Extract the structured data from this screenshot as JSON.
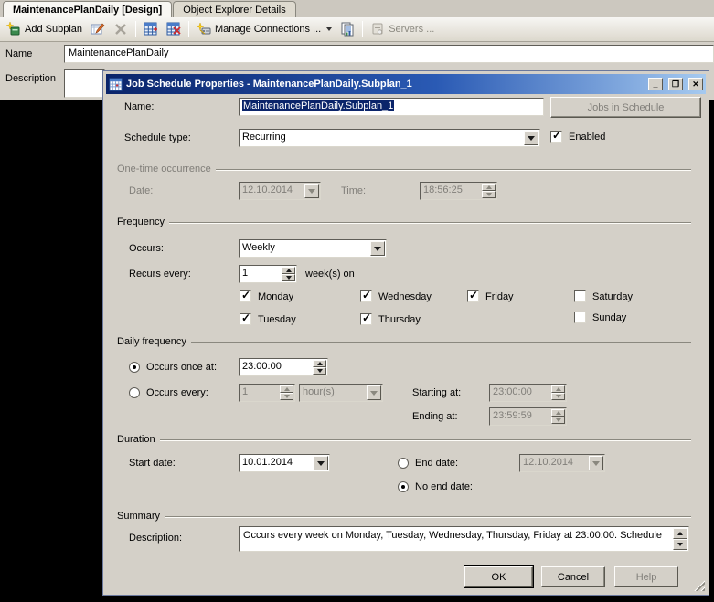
{
  "tabs": [
    {
      "label": "MaintenancePlanDaily [Design]",
      "active": true
    },
    {
      "label": "Object Explorer Details",
      "active": false
    }
  ],
  "toolbar": {
    "add_subplan_label": "Add Subplan",
    "manage_connections_label": "Manage Connections ...",
    "servers_label": "Servers ...",
    "icons": {
      "add_subplan": "add-subplan-icon",
      "edit_subplan": "edit-subplan-icon",
      "delete_subplan": "delete-subplan-icon",
      "subplan_schedule": "subplan-schedule-icon",
      "remove_schedule": "remove-schedule-icon",
      "manage_connections": "manage-connections-icon",
      "reporting": "reporting-icon",
      "servers": "servers-icon"
    }
  },
  "form": {
    "name_label": "Name",
    "name_value": "MaintenancePlanDaily",
    "description_label": "Description"
  },
  "dialog": {
    "title": "Job Schedule Properties - MaintenancePlanDaily.Subplan_1",
    "window_controls": {
      "minimize": "_",
      "maximize": "❐",
      "close": "✕"
    },
    "name_label": "Name:",
    "name_value": "MaintenancePlanDaily.Subplan_1",
    "jobs_in_schedule_label": "Jobs in Schedule",
    "schedule_type_label": "Schedule type:",
    "schedule_type_value": "Recurring",
    "enabled_label": "Enabled",
    "enabled_checked": true,
    "one_time": {
      "title": "One-time occurrence",
      "disabled": true,
      "date_label": "Date:",
      "date_value": "12.10.2014",
      "time_label": "Time:",
      "time_value": "18:56:25"
    },
    "frequency": {
      "title": "Frequency",
      "occurs_label": "Occurs:",
      "occurs_value": "Weekly",
      "recurs_label": "Recurs every:",
      "recurs_value": "1",
      "recurs_suffix": "week(s) on",
      "days": [
        {
          "label": "Monday",
          "checked": true
        },
        {
          "label": "Wednesday",
          "checked": true
        },
        {
          "label": "Friday",
          "checked": true
        },
        {
          "label": "Saturday",
          "checked": false
        },
        {
          "label": "Tuesday",
          "checked": true
        },
        {
          "label": "Thursday",
          "checked": true
        },
        {
          "label": "Sunday",
          "checked": false
        }
      ]
    },
    "daily_frequency": {
      "title": "Daily frequency",
      "occurs_once_label": "Occurs once at:",
      "occurs_once_selected": true,
      "occurs_once_value": "23:00:00",
      "occurs_every_label": "Occurs every:",
      "occurs_every_selected": false,
      "occurs_every_value": "1",
      "occurs_every_unit": "hour(s)",
      "starting_label": "Starting at:",
      "starting_value": "23:00:00",
      "ending_label": "Ending at:",
      "ending_value": "23:59:59"
    },
    "duration": {
      "title": "Duration",
      "start_date_label": "Start date:",
      "start_date_value": "10.01.2014",
      "end_date_label": "End date:",
      "end_date_selected": false,
      "end_date_value": "12.10.2014",
      "no_end_date_label": "No end date:",
      "no_end_date_selected": true
    },
    "summary": {
      "title": "Summary",
      "description_label": "Description:",
      "description_value": "Occurs every week on Monday, Tuesday, Wednesday, Thursday, Friday at 23:00:00. Schedule"
    },
    "buttons": {
      "ok": "OK",
      "cancel": "Cancel",
      "help": "Help"
    },
    "colors": {
      "title_gradient_start": "#0a246a",
      "title_gradient_end": "#a6caf0",
      "selection_background": "#0a246a",
      "dialog_background": "#d4d0c8",
      "disabled_text": "#808080"
    }
  }
}
